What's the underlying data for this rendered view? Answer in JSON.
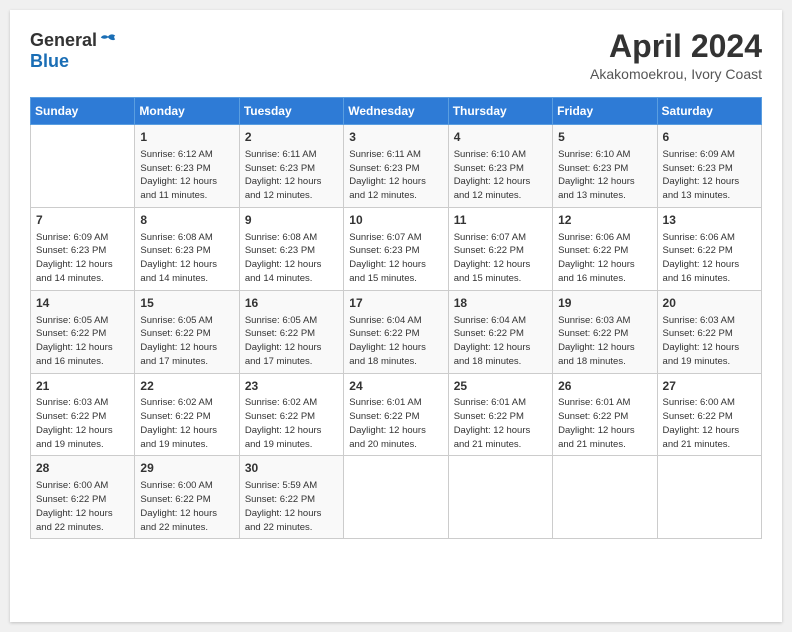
{
  "header": {
    "logo_general": "General",
    "logo_blue": "Blue",
    "month_title": "April 2024",
    "location": "Akakomoekrou, Ivory Coast"
  },
  "days_of_week": [
    "Sunday",
    "Monday",
    "Tuesday",
    "Wednesday",
    "Thursday",
    "Friday",
    "Saturday"
  ],
  "weeks": [
    [
      {
        "num": "",
        "info": ""
      },
      {
        "num": "1",
        "info": "Sunrise: 6:12 AM\nSunset: 6:23 PM\nDaylight: 12 hours\nand 11 minutes."
      },
      {
        "num": "2",
        "info": "Sunrise: 6:11 AM\nSunset: 6:23 PM\nDaylight: 12 hours\nand 12 minutes."
      },
      {
        "num": "3",
        "info": "Sunrise: 6:11 AM\nSunset: 6:23 PM\nDaylight: 12 hours\nand 12 minutes."
      },
      {
        "num": "4",
        "info": "Sunrise: 6:10 AM\nSunset: 6:23 PM\nDaylight: 12 hours\nand 12 minutes."
      },
      {
        "num": "5",
        "info": "Sunrise: 6:10 AM\nSunset: 6:23 PM\nDaylight: 12 hours\nand 13 minutes."
      },
      {
        "num": "6",
        "info": "Sunrise: 6:09 AM\nSunset: 6:23 PM\nDaylight: 12 hours\nand 13 minutes."
      }
    ],
    [
      {
        "num": "7",
        "info": "Sunrise: 6:09 AM\nSunset: 6:23 PM\nDaylight: 12 hours\nand 14 minutes."
      },
      {
        "num": "8",
        "info": "Sunrise: 6:08 AM\nSunset: 6:23 PM\nDaylight: 12 hours\nand 14 minutes."
      },
      {
        "num": "9",
        "info": "Sunrise: 6:08 AM\nSunset: 6:23 PM\nDaylight: 12 hours\nand 14 minutes."
      },
      {
        "num": "10",
        "info": "Sunrise: 6:07 AM\nSunset: 6:23 PM\nDaylight: 12 hours\nand 15 minutes."
      },
      {
        "num": "11",
        "info": "Sunrise: 6:07 AM\nSunset: 6:22 PM\nDaylight: 12 hours\nand 15 minutes."
      },
      {
        "num": "12",
        "info": "Sunrise: 6:06 AM\nSunset: 6:22 PM\nDaylight: 12 hours\nand 16 minutes."
      },
      {
        "num": "13",
        "info": "Sunrise: 6:06 AM\nSunset: 6:22 PM\nDaylight: 12 hours\nand 16 minutes."
      }
    ],
    [
      {
        "num": "14",
        "info": "Sunrise: 6:05 AM\nSunset: 6:22 PM\nDaylight: 12 hours\nand 16 minutes."
      },
      {
        "num": "15",
        "info": "Sunrise: 6:05 AM\nSunset: 6:22 PM\nDaylight: 12 hours\nand 17 minutes."
      },
      {
        "num": "16",
        "info": "Sunrise: 6:05 AM\nSunset: 6:22 PM\nDaylight: 12 hours\nand 17 minutes."
      },
      {
        "num": "17",
        "info": "Sunrise: 6:04 AM\nSunset: 6:22 PM\nDaylight: 12 hours\nand 18 minutes."
      },
      {
        "num": "18",
        "info": "Sunrise: 6:04 AM\nSunset: 6:22 PM\nDaylight: 12 hours\nand 18 minutes."
      },
      {
        "num": "19",
        "info": "Sunrise: 6:03 AM\nSunset: 6:22 PM\nDaylight: 12 hours\nand 18 minutes."
      },
      {
        "num": "20",
        "info": "Sunrise: 6:03 AM\nSunset: 6:22 PM\nDaylight: 12 hours\nand 19 minutes."
      }
    ],
    [
      {
        "num": "21",
        "info": "Sunrise: 6:03 AM\nSunset: 6:22 PM\nDaylight: 12 hours\nand 19 minutes."
      },
      {
        "num": "22",
        "info": "Sunrise: 6:02 AM\nSunset: 6:22 PM\nDaylight: 12 hours\nand 19 minutes."
      },
      {
        "num": "23",
        "info": "Sunrise: 6:02 AM\nSunset: 6:22 PM\nDaylight: 12 hours\nand 19 minutes."
      },
      {
        "num": "24",
        "info": "Sunrise: 6:01 AM\nSunset: 6:22 PM\nDaylight: 12 hours\nand 20 minutes."
      },
      {
        "num": "25",
        "info": "Sunrise: 6:01 AM\nSunset: 6:22 PM\nDaylight: 12 hours\nand 21 minutes."
      },
      {
        "num": "26",
        "info": "Sunrise: 6:01 AM\nSunset: 6:22 PM\nDaylight: 12 hours\nand 21 minutes."
      },
      {
        "num": "27",
        "info": "Sunrise: 6:00 AM\nSunset: 6:22 PM\nDaylight: 12 hours\nand 21 minutes."
      }
    ],
    [
      {
        "num": "28",
        "info": "Sunrise: 6:00 AM\nSunset: 6:22 PM\nDaylight: 12 hours\nand 22 minutes."
      },
      {
        "num": "29",
        "info": "Sunrise: 6:00 AM\nSunset: 6:22 PM\nDaylight: 12 hours\nand 22 minutes."
      },
      {
        "num": "30",
        "info": "Sunrise: 5:59 AM\nSunset: 6:22 PM\nDaylight: 12 hours\nand 22 minutes."
      },
      {
        "num": "",
        "info": ""
      },
      {
        "num": "",
        "info": ""
      },
      {
        "num": "",
        "info": ""
      },
      {
        "num": "",
        "info": ""
      }
    ]
  ]
}
